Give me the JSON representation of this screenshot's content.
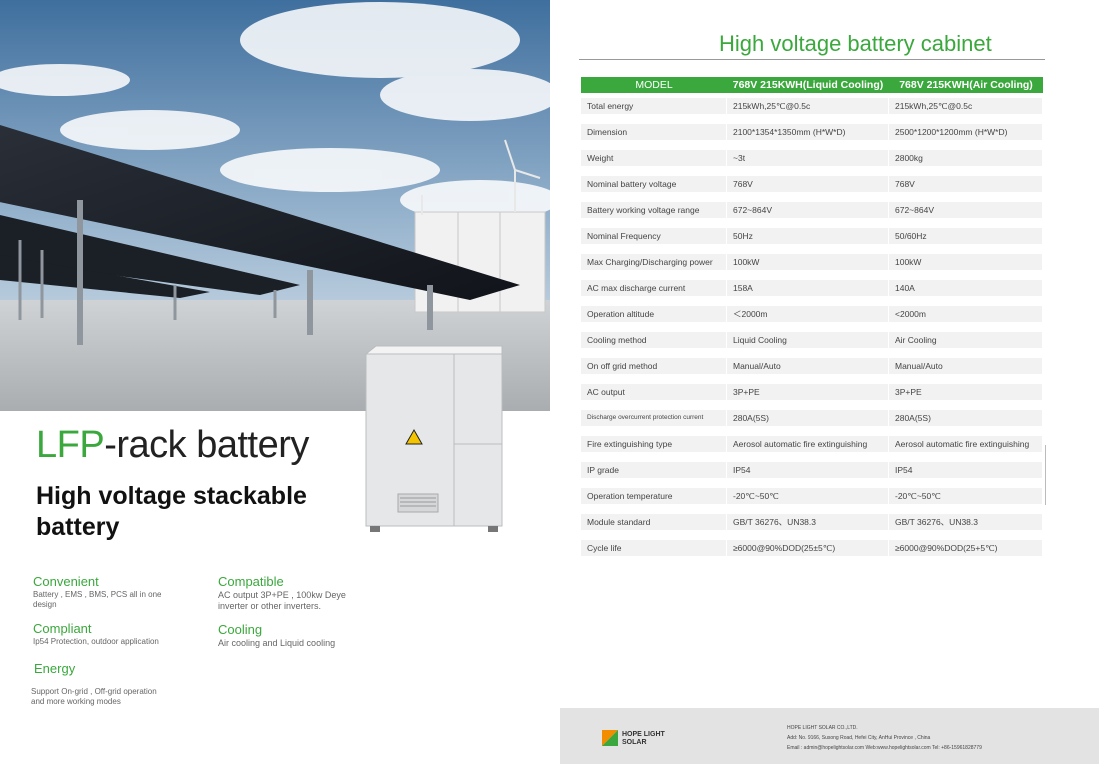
{
  "left": {
    "title_accent": "LFP",
    "title_rest": "-rack battery",
    "subtitle": "High voltage stackable battery",
    "features": [
      {
        "heading": "Convenient",
        "desc": "Battery , EMS , BMS, PCS all in one design"
      },
      {
        "heading": "Compatible",
        "desc": "AC output 3P+PE , 100kw Deye inverter or other inverters."
      },
      {
        "heading": "Compliant",
        "desc": "Ip54 Protection, outdoor application"
      },
      {
        "heading": "Cooling",
        "desc": "Air cooling and Liquid cooling"
      },
      {
        "heading": "Energy",
        "desc": "Support On-grid , Off-grid operation and more working modes"
      }
    ]
  },
  "right": {
    "title": "High voltage battery cabinet",
    "table": {
      "headers": [
        "MODEL",
        "768V 215KWH(Liquid Cooling)",
        "768V 215KWH(Air Cooling)"
      ],
      "rows": [
        [
          "Total energy",
          "215kWh,25℃@0.5c",
          "215kWh,25℃@0.5c"
        ],
        [
          "Dimension",
          "2100*1354*1350mm (H*W*D)",
          "2500*1200*1200mm (H*W*D)"
        ],
        [
          "Weight",
          "~3t",
          "2800kg"
        ],
        [
          "Nominal battery voltage",
          "768V",
          "768V"
        ],
        [
          "Battery working voltage range",
          "672~864V",
          "672~864V"
        ],
        [
          "Nominal Frequency",
          "50Hz",
          "50/60Hz"
        ],
        [
          "Max Charging/Discharging power",
          "100kW",
          "100kW"
        ],
        [
          "AC max discharge current",
          "158A",
          "140A"
        ],
        [
          "Operation altitude",
          "＜2000m",
          "<2000m"
        ],
        [
          "Cooling method",
          "Liquid Cooling",
          "Air Cooling"
        ],
        [
          "On off grid method",
          "Manual/Auto",
          "Manual/Auto"
        ],
        [
          "AC output",
          "3P+PE",
          "3P+PE"
        ],
        [
          "Discharge overcurrent protection current",
          "280A(5S)",
          "280A(5S)"
        ],
        [
          "Fire extinguishing type",
          "Aerosol automatic fire extinguishing",
          "Aerosol automatic fire extinguishing"
        ],
        [
          "IP grade",
          "IP54",
          "IP54"
        ],
        [
          "Operation temperature",
          "-20℃~50℃",
          "-20℃~50℃"
        ],
        [
          "Module standard",
          "GB/T 36276、UN38.3",
          "GB/T 36276、UN38.3"
        ],
        [
          "Cycle life",
          "≥6000@90%DOD(25±5℃)",
          "≥6000@90%DOD(25+5℃)"
        ]
      ]
    }
  },
  "footer": {
    "logo_line1": "HOPE LIGHT",
    "logo_line2": "SOLAR",
    "company": "HOPE LIGHT SOLAR CO.,LTD.",
    "address": "Add: No. 9166, Susong Road, Hefei City, AnHui Province , China",
    "contact": "Email : admin@hopelightsolar.com     Web:www.hopelightsolar.com  Tel: +86-15961828779"
  },
  "colors": {
    "accent": "#3aa83c",
    "footer_bg": "#e3e3e3"
  }
}
